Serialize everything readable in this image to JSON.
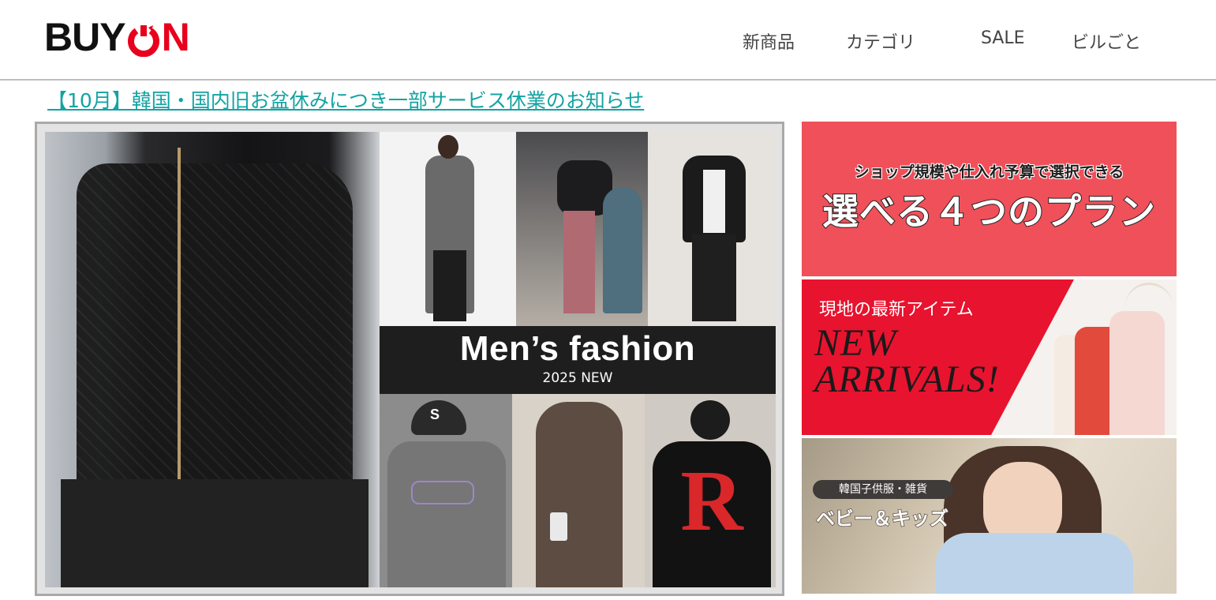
{
  "header": {
    "logo": {
      "left": "BUY",
      "right": "N"
    },
    "nav": [
      "新商品",
      "カテゴリ",
      "SALE",
      "ビルごと"
    ]
  },
  "notice": {
    "text": "【10月】韓国・国内旧お盆休みにつき一部サービス休業のお知らせ"
  },
  "main_banner": {
    "title": "Men’s fashion",
    "subtitle": "2025 NEW"
  },
  "side_banners": [
    {
      "small": "ショップ規模や仕入れ予算で選択できる",
      "big": "選べる４つのプラン"
    },
    {
      "label": "現地の最新アイテム",
      "line1": "NEW",
      "line2": "ARRIVALS!"
    },
    {
      "pill": "韓国子供服・雑貨",
      "title": "ベビー＆キッズ"
    }
  ],
  "colors": {
    "brand_red": "#e8001c",
    "notice_link": "#14a3a3",
    "plan_banner": "#f0505a",
    "arrivals_red": "#e8132e"
  }
}
